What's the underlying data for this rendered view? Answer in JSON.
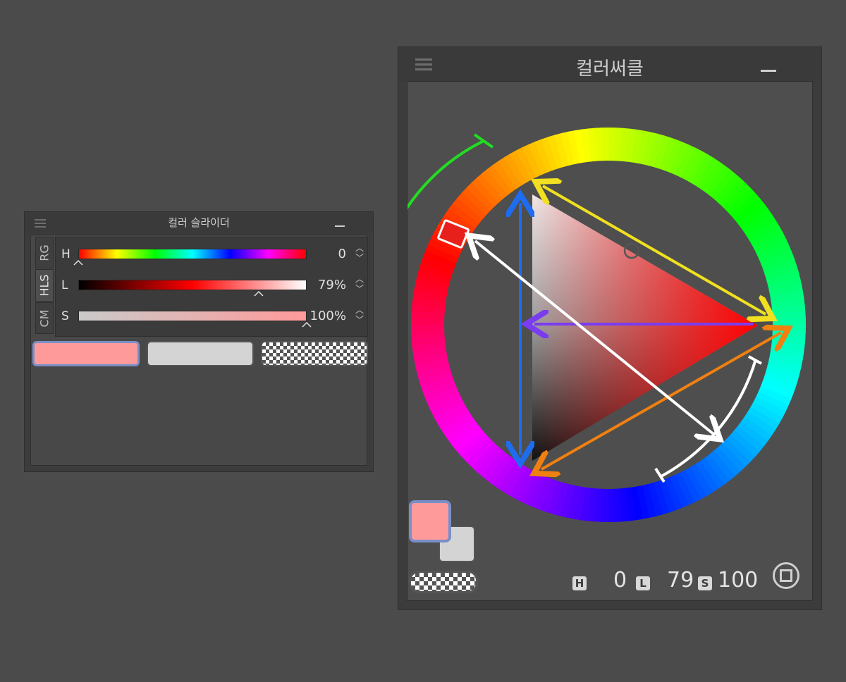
{
  "slider_panel": {
    "title": "컬러 슬라이더",
    "tabs": [
      "RG",
      "HLS",
      "CM"
    ],
    "active_tab": "HLS",
    "rows": [
      {
        "label": "H",
        "value": "0"
      },
      {
        "label": "L",
        "value": "79%"
      },
      {
        "label": "S",
        "value": "100%"
      }
    ],
    "levels": {
      "hue": 0,
      "lightness": 0.79,
      "saturation": 1.0
    },
    "main_color": "#ff9a9a",
    "sub_color": "#d4d4d4"
  },
  "circle_panel": {
    "title": "컬러써클",
    "h_value": "0",
    "l_value": "79",
    "s_value": "100",
    "h_icon": "H",
    "l_icon": "L",
    "s_icon": "S",
    "main_color": "#ff9a9a",
    "sub_color": "#d4d4d4"
  },
  "colors": {
    "background": "#4b4b4b",
    "panel": "#3c3c3c",
    "annotation_green": "#22dd22",
    "annotation_yellow": "#f0e020",
    "annotation_blue": "#1e6cf0",
    "annotation_purple": "#7a3cf0",
    "annotation_orange": "#f08010",
    "annotation_white": "#ffffff"
  }
}
